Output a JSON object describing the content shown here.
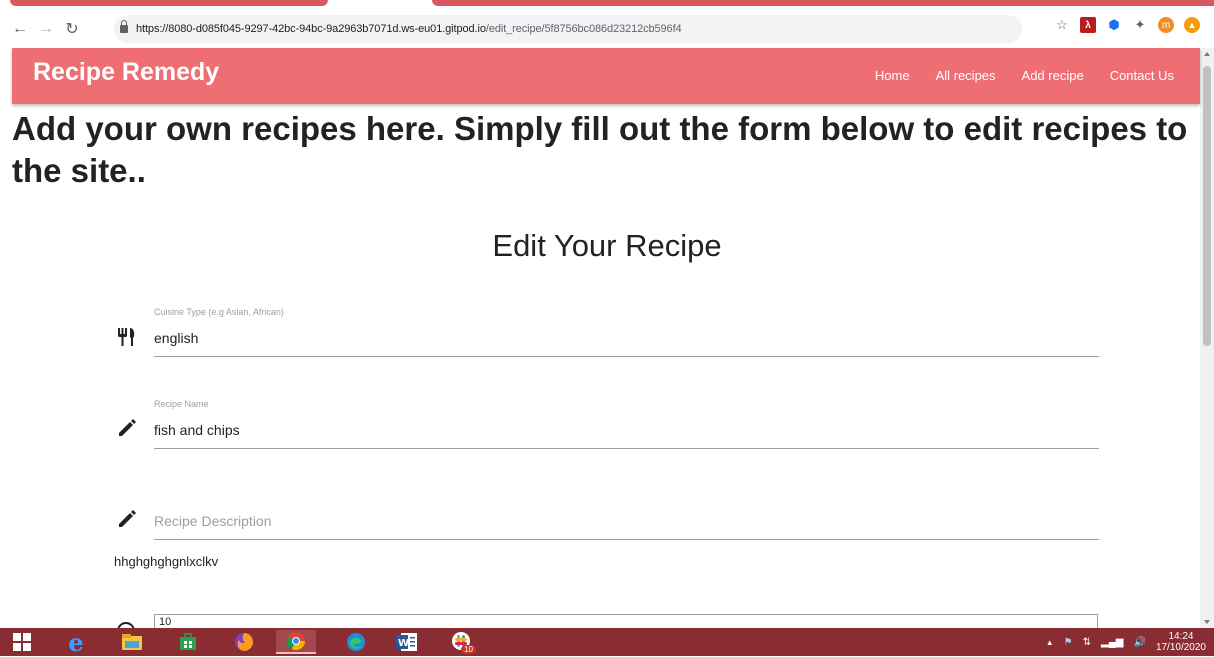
{
  "browser": {
    "url_host": "https://8080-d085f045-9297-42bc-94bc-9a2963b7071d.ws-eu01.gitpod.io",
    "url_path": "/edit_recipe/5f8756bc086d23212cb596f4",
    "avatar_letter": "m"
  },
  "navbar": {
    "brand": "Recipe Remedy",
    "links": [
      "Home",
      "All recipes",
      "Add recipe",
      "Contact Us"
    ]
  },
  "page": {
    "headline": "Add your own recipes here. Simply fill out the form below to edit recipes to the site..",
    "form_title": "Edit Your Recipe"
  },
  "form": {
    "cuisine": {
      "label": "Cuisine Type (e.g Asian, African)",
      "value": "english",
      "icon": "restaurant-icon"
    },
    "recipe_name": {
      "label": "Recipe Name",
      "value": "fish and chips",
      "icon": "pencil-icon"
    },
    "recipe_description": {
      "placeholder": "Recipe Description",
      "value": "hhghghghgnlxclkv",
      "icon": "pencil-icon"
    },
    "number_field": {
      "value": "10"
    }
  },
  "taskbar": {
    "slack_badge": "10",
    "time": "14:24",
    "date": "17/10/2020"
  },
  "colors": {
    "navbar": "#ee6e73",
    "taskbar": "#8a2d33"
  }
}
